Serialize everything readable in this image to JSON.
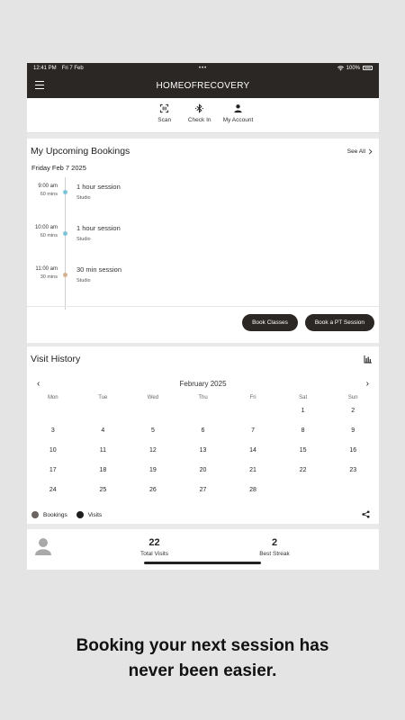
{
  "status_bar": {
    "time": "12:41 PM",
    "date": "Fri 7 Feb",
    "battery": "100%"
  },
  "app_bar": {
    "title": "HOMEOFRECOVERY",
    "menu_icon": "hamburger-icon"
  },
  "actions": [
    {
      "label": "Scan",
      "icon": "barcode-scan-icon"
    },
    {
      "label": "Check In",
      "icon": "bluetooth-icon"
    },
    {
      "label": "My Account",
      "icon": "person-icon"
    }
  ],
  "bookings": {
    "title": "My Upcoming Bookings",
    "see_all": "See All",
    "date": "Friday Feb 7 2025",
    "items": [
      {
        "time": "9:00 am",
        "duration": "60 mins",
        "name": "1 hour session",
        "location": "Studio",
        "color": "#7fc3d8"
      },
      {
        "time": "10:00 am",
        "duration": "60 mins",
        "name": "1 hour session",
        "location": "Studio",
        "color": "#7fc3d8"
      },
      {
        "time": "11:00 am",
        "duration": "30 mins",
        "name": "30 min session",
        "location": "Studio",
        "color": "#d6b08d"
      }
    ],
    "book_classes": "Book Classes",
    "book_pt": "Book a PT Session"
  },
  "visit_history": {
    "title": "Visit History",
    "month": "February 2025",
    "weekdays": [
      "Mon",
      "Tue",
      "Wed",
      "Thu",
      "Fri",
      "Sat",
      "Sun"
    ],
    "days": [
      "",
      "",
      "",
      "",
      "",
      "1",
      "2",
      "3",
      "4",
      "5",
      "6",
      "7",
      "8",
      "9",
      "10",
      "11",
      "12",
      "13",
      "14",
      "15",
      "16",
      "17",
      "18",
      "19",
      "20",
      "21",
      "22",
      "23",
      "24",
      "25",
      "26",
      "27",
      "28",
      "",
      ""
    ],
    "legend": [
      {
        "label": "Bookings",
        "color": "#6b6460"
      },
      {
        "label": "Visits",
        "color": "#1e1e1e"
      }
    ]
  },
  "stats": {
    "total_visits": {
      "value": "22",
      "label": "Total Visits"
    },
    "best_streak": {
      "value": "2",
      "label": "Best Streak"
    }
  },
  "caption": {
    "line1": "Booking your next session has",
    "line2": "never been easier."
  }
}
